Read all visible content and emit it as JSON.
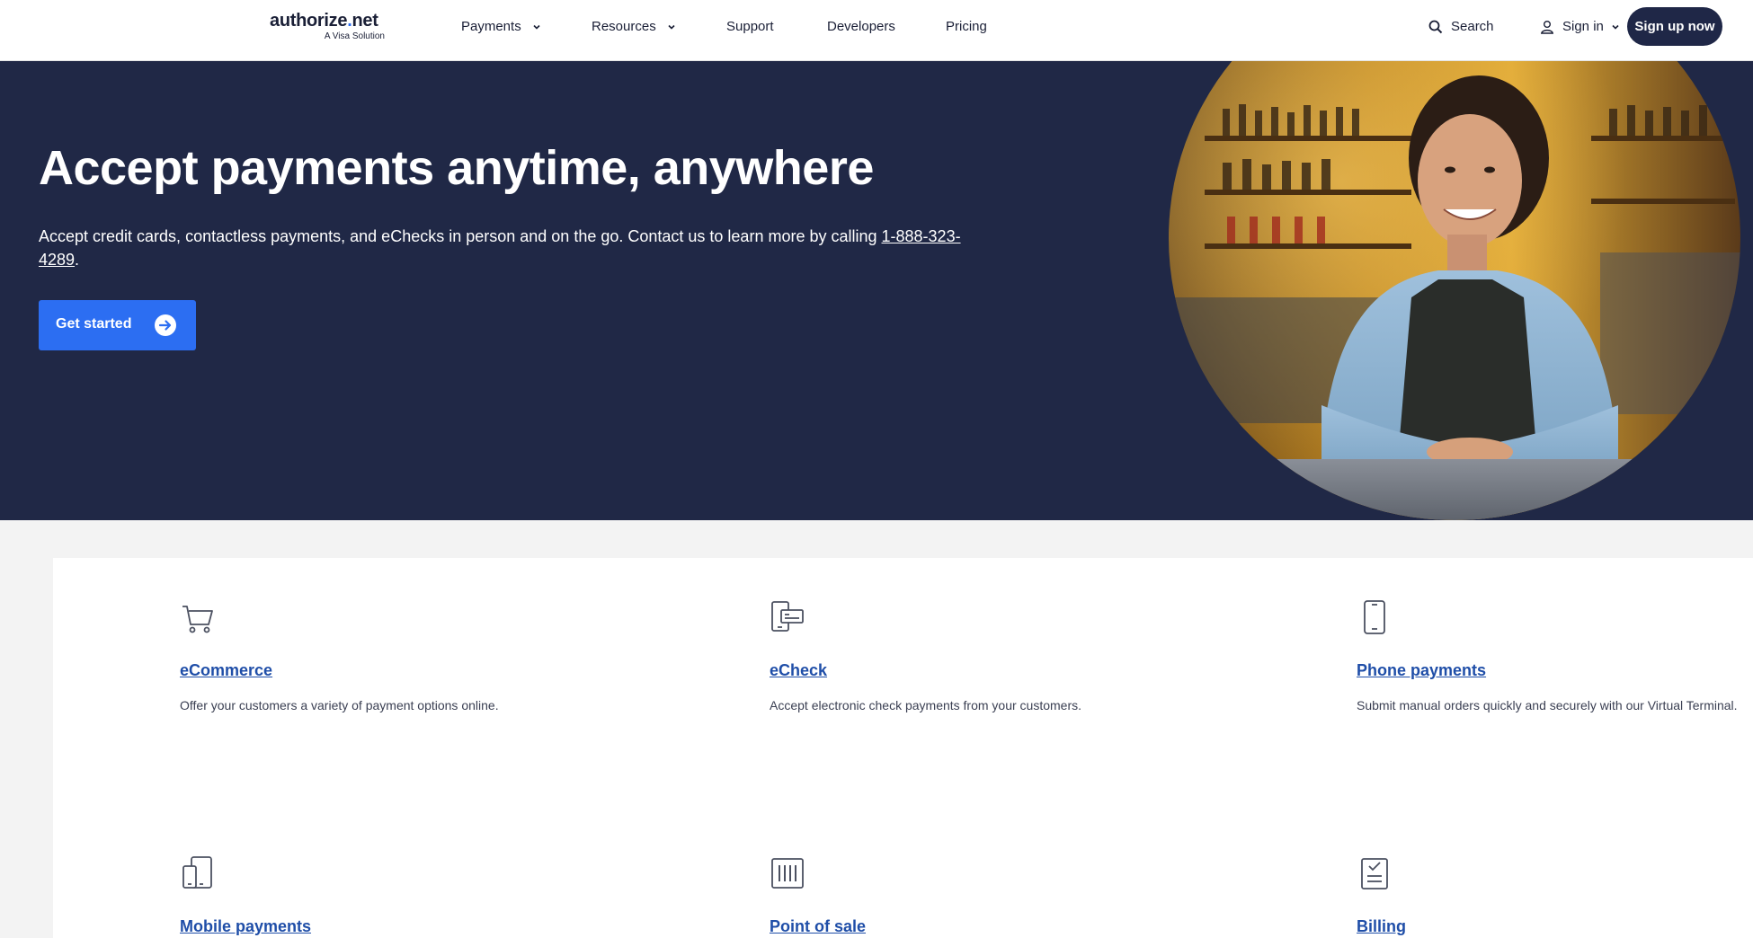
{
  "header": {
    "logo_main": "authorize",
    "logo_dot": ".",
    "logo_end": "net",
    "logo_sub": "A Visa Solution",
    "nav": {
      "payments": "Payments",
      "resources": "Resources",
      "support": "Support",
      "developers": "Developers",
      "pricing": "Pricing"
    },
    "search_label": "Search",
    "signin_label": "Sign in",
    "signup_label": "Sign up now"
  },
  "hero": {
    "title": "Accept payments anytime, anywhere",
    "description": "Accept credit cards, contactless payments, and eChecks in person and on the go. Contact us to learn more by calling ",
    "phone": "1-888-323-4289",
    "period": ".",
    "cta_label": "Get started"
  },
  "products": {
    "ecommerce": {
      "title": "eCommerce",
      "desc": "Offer your customers a variety of payment options online.",
      "icon": "shopping-cart-icon"
    },
    "echeck": {
      "title": "eCheck",
      "desc": "Accept electronic check payments from your customers.",
      "icon": "check-terminal-icon"
    },
    "phone": {
      "title": "Phone payments",
      "desc": "Submit manual orders quickly and securely with our Virtual Terminal.",
      "icon": "phone-icon"
    },
    "mobile": {
      "title": "Mobile payments",
      "icon": "mobile-devices-icon"
    },
    "pos": {
      "title": "Point of sale",
      "icon": "barcode-icon"
    },
    "billing": {
      "title": "Billing",
      "icon": "billing-clipboard-icon"
    }
  },
  "colors": {
    "hero_bg": "#202846",
    "accent": "#2c6ef2",
    "link": "#1f4ea8",
    "signup_bg": "#1f2747"
  }
}
